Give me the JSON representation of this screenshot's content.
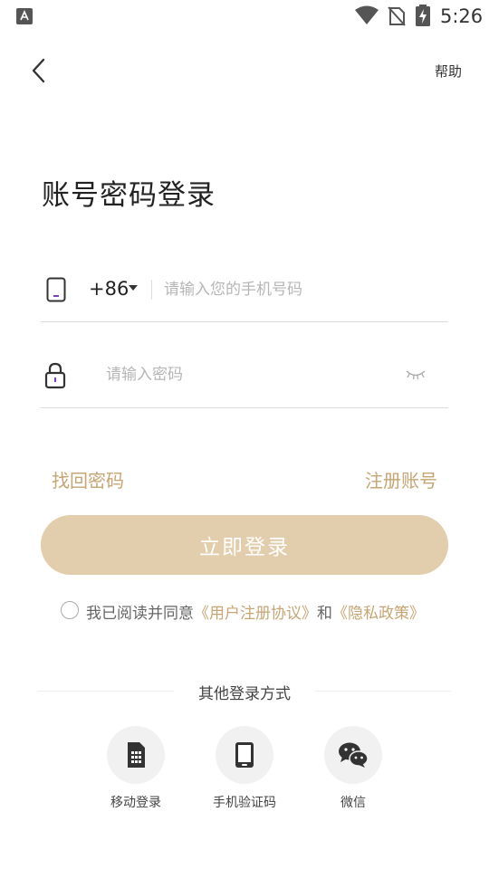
{
  "status_bar": {
    "time": "5:26"
  },
  "header": {
    "help_label": "帮助"
  },
  "page": {
    "title": "账号密码登录"
  },
  "phone": {
    "country_code": "+86",
    "placeholder": "请输入您的手机号码"
  },
  "password": {
    "placeholder": "请输入密码"
  },
  "links": {
    "forgot": "找回密码",
    "register": "注册账号"
  },
  "login_button": "立即登录",
  "agreement": {
    "prefix": "我已阅读并同意",
    "user_agreement": "《用户注册协议》",
    "and": "和",
    "privacy": "《隐私政策》"
  },
  "other_login": {
    "title": "其他登录方式",
    "options": [
      {
        "label": "移动登录",
        "icon": "sim-card-icon"
      },
      {
        "label": "手机验证码",
        "icon": "mobile-phone-icon"
      },
      {
        "label": "微信",
        "icon": "wechat-icon"
      }
    ]
  },
  "colors": {
    "accent": "#c6a573",
    "button": "#e2cdac",
    "phone_icon_accent": "#7b3fbf"
  }
}
